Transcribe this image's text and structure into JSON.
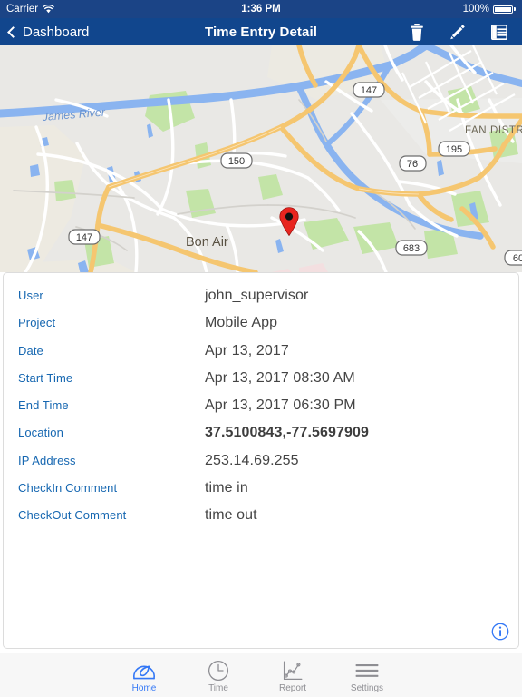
{
  "status_bar": {
    "carrier": "Carrier",
    "wifi_icon": "wifi-icon",
    "time": "1:36 PM",
    "battery_percent": "100%",
    "battery_icon": "battery-full-icon"
  },
  "nav_bar": {
    "back_label": "Dashboard",
    "back_icon": "chevron-left-icon",
    "title": "Time Entry Detail",
    "actions": [
      {
        "name": "delete-button",
        "icon": "trash-icon"
      },
      {
        "name": "edit-button",
        "icon": "pencil-icon"
      },
      {
        "name": "list-button",
        "icon": "list-grid-icon"
      }
    ]
  },
  "map": {
    "pin_icon": "map-pin-icon",
    "labels": {
      "river": "James River",
      "city": "Bon Air",
      "district": "FAN DISTRICT"
    },
    "route_shields": [
      "150",
      "147",
      "147",
      "76",
      "195",
      "683",
      "60"
    ],
    "colors": {
      "land": "#e9e8e5",
      "land_alt": "#eceae1",
      "water": "#8ab4f0",
      "park": "#b8e1a0",
      "highway": "#f5c670",
      "road": "#ffffff"
    }
  },
  "detail": {
    "rows": [
      {
        "label": "User",
        "value": "john_supervisor",
        "bold": false
      },
      {
        "label": "Project",
        "value": "Mobile App",
        "bold": false
      },
      {
        "label": "Date",
        "value": "Apr 13, 2017",
        "bold": false
      },
      {
        "label": "Start Time",
        "value": "Apr 13, 2017 08:30 AM",
        "bold": false
      },
      {
        "label": "End Time",
        "value": "Apr 13, 2017 06:30 PM",
        "bold": false
      },
      {
        "label": "Location",
        "value": "37.5100843,-77.5697909",
        "bold": true
      },
      {
        "label": "IP Address",
        "value": "253.14.69.255",
        "bold": false
      },
      {
        "label": "CheckIn Comment",
        "value": "time in",
        "bold": false
      },
      {
        "label": "CheckOut Comment",
        "value": "time out",
        "bold": false
      }
    ],
    "info_icon": "info-circle-icon"
  },
  "tab_bar": {
    "items": [
      {
        "label": "Home",
        "icon": "gauge-icon",
        "active": true
      },
      {
        "label": "Time",
        "icon": "clock-icon",
        "active": false
      },
      {
        "label": "Report",
        "icon": "line-chart-icon",
        "active": false
      },
      {
        "label": "Settings",
        "icon": "hamburger-icon",
        "active": false
      }
    ]
  },
  "colors": {
    "nav_blue": "#11468d",
    "status_blue": "#1b4486",
    "label_blue": "#1667b1",
    "value_gray": "#444444",
    "tab_active": "#3478f6",
    "tab_inactive": "#8e8e93",
    "pin_red": "#e8251f"
  }
}
